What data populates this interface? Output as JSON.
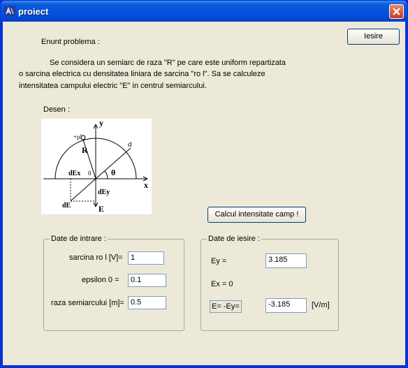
{
  "window": {
    "title": "proiect"
  },
  "buttons": {
    "iesire": "Iesire",
    "calcul": "Calcul intensitate camp !"
  },
  "problem": {
    "heading": "Enunt problema :",
    "line1": "Se considera un semiarc de raza \"R\" pe care este uniform repartizata",
    "line2": "o sarcina electrica cu densitatea liniara de sarcina \"ro l\".    Sa se calculeze",
    "line3": "intensitatea campului electric \"E\" in centrul semiarcului."
  },
  "drawing": {
    "label": "Desen :",
    "labels": {
      "y": "y",
      "x": "x",
      "rho": "+ρl",
      "R": "R",
      "d": "d",
      "theta": "θ",
      "zero": "0",
      "dEx": "dEx",
      "dEy": "dEy",
      "dE": "dE",
      "E": "E"
    }
  },
  "inputs_group": {
    "title": "Date de intrare :",
    "fields": [
      {
        "label": "sarcina ro l [V]=",
        "value": "1"
      },
      {
        "label": "epsilon 0 =",
        "value": "0.1"
      },
      {
        "label": "raza semiarcului [m]=",
        "value": "0.5"
      }
    ]
  },
  "outputs_group": {
    "title": "Date de iesire :",
    "ey_label": "Ey =",
    "ey_value": "3.185",
    "ex_label": "Ex = 0",
    "e_label": "E= -Ey=",
    "e_value": "-3.185",
    "e_unit": "[V/m]"
  },
  "colors": {
    "titlebar": "#0451e0",
    "background": "#ece9d8",
    "close": "#c53b1a"
  }
}
